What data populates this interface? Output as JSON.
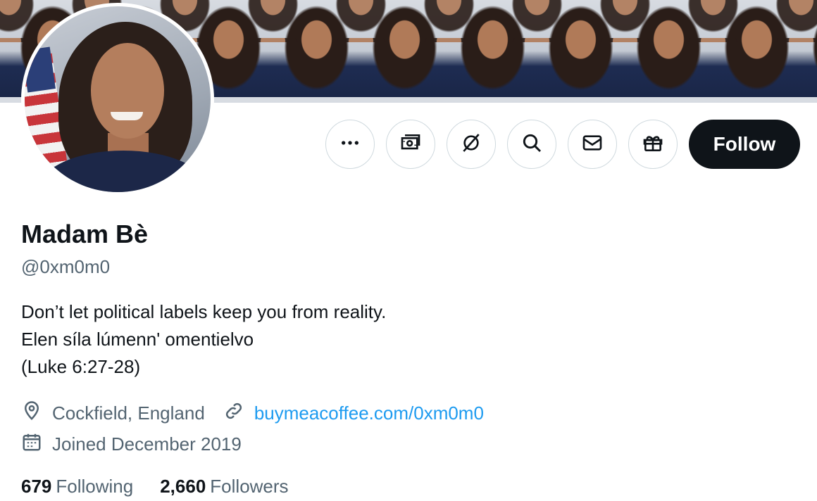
{
  "profile": {
    "display_name": "Madam Bè",
    "handle": "@0xm0m0",
    "bio_lines": [
      "Don’t let political labels keep you from reality.",
      "Elen síla lúmenn' omentielvo",
      "(Luke 6:27-28)"
    ],
    "location": "Cockfield, England",
    "website": "buymeacoffee.com/0xm0m0",
    "joined": "Joined December 2019"
  },
  "actions": {
    "more_icon": "more-horizontal-icon",
    "tip_icon": "money-icon",
    "grok_icon": "grok-slash-icon",
    "search_icon": "search-icon",
    "message_icon": "envelope-icon",
    "gift_icon": "gift-icon",
    "follow_label": "Follow"
  },
  "stats": {
    "following_count": "679",
    "following_label": "Following",
    "followers_count": "2,660",
    "followers_label": "Followers"
  },
  "colors": {
    "text_primary": "#0f1419",
    "text_secondary": "#536471",
    "link": "#1d9bf0",
    "follow_bg": "#0f1419",
    "border": "#cfd9de"
  }
}
